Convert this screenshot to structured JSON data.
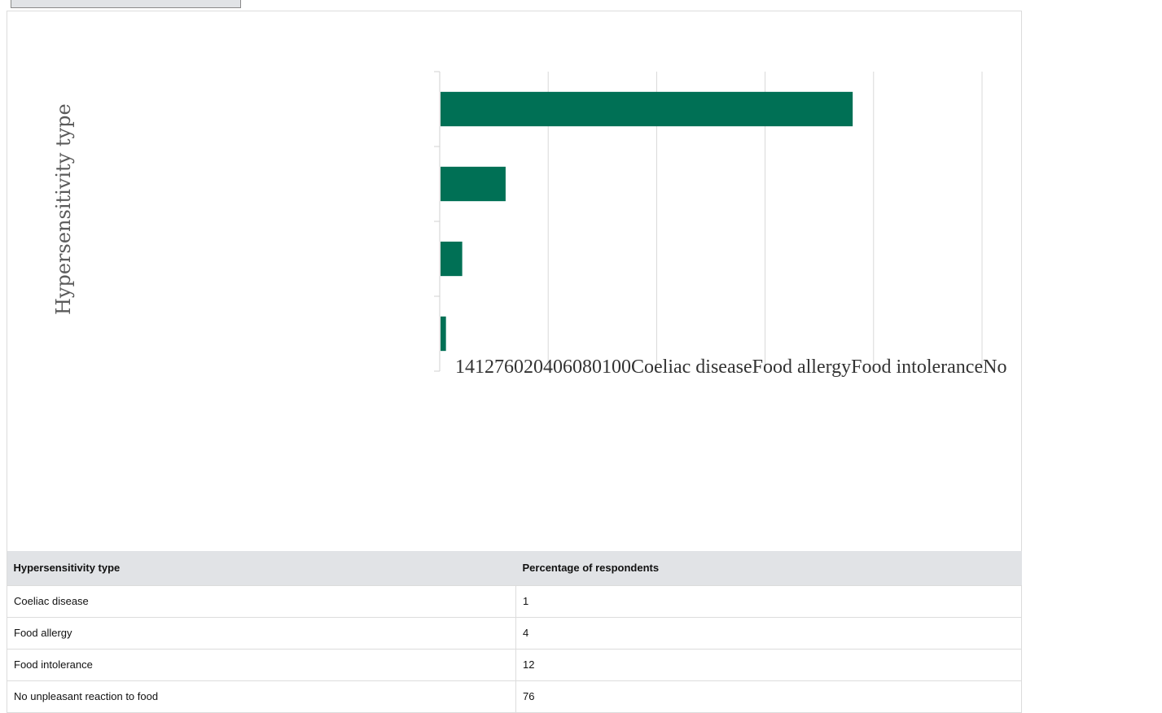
{
  "chart_data": {
    "type": "bar",
    "orientation": "horizontal",
    "ylabel": "Hypersensitivity type",
    "categories": [
      "No unpleasant reaction to food",
      "Food intolerance",
      "Food allergy",
      "Coeliac disease"
    ],
    "values": [
      76,
      12,
      4,
      1
    ],
    "xlim": [
      0,
      100
    ],
    "grid": true,
    "bar_color": "#007055"
  },
  "overflow_label": "141276020406080100Coeliac diseaseFood allergyFood intoleranceNo",
  "table": {
    "headers": [
      "Hypersensitivity type",
      "Percentage of respondents"
    ],
    "rows": [
      [
        "Coeliac disease",
        "1"
      ],
      [
        "Food allergy",
        "4"
      ],
      [
        "Food intolerance",
        "12"
      ],
      [
        "No unpleasant reaction to food",
        "76"
      ]
    ]
  }
}
